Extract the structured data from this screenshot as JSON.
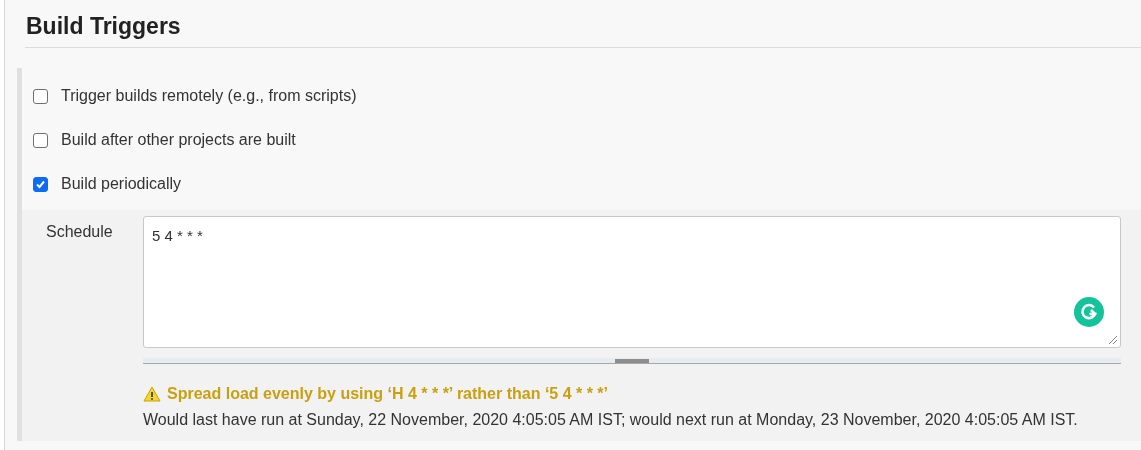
{
  "section": {
    "title": "Build Triggers"
  },
  "triggers": [
    {
      "label": "Trigger builds remotely (e.g., from scripts)",
      "checked": false
    },
    {
      "label": "Build after other projects are built",
      "checked": false
    },
    {
      "label": "Build periodically",
      "checked": true
    }
  ],
  "schedule": {
    "label": "Schedule",
    "value": "5 4 * * *",
    "warning": "Spread load evenly by using ‘H 4 * * *’ rather than ‘5 4 * * *’",
    "info": "Would last have run at Sunday, 22 November, 2020 4:05:05 AM IST; would next run at Monday, 23 November, 2020 4:05:05 AM IST."
  }
}
